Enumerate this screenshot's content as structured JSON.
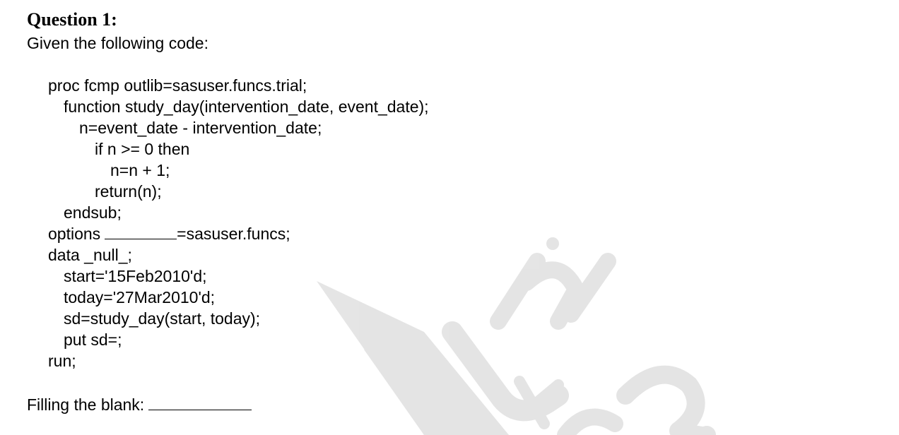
{
  "question": {
    "title": "Question 1:",
    "intro": "Given the following code:"
  },
  "code": {
    "lines": [
      {
        "text": "proc fcmp outlib=sasuser.funcs.trial;"
      },
      {
        "text": "function study_day(intervention_date, event_date);"
      },
      {
        "text": "n=event_date - intervention_date;"
      },
      {
        "text": "if n >= 0 then"
      },
      {
        "text": "n=n + 1;"
      },
      {
        "text": "return(n);"
      },
      {
        "text": "endsub;"
      },
      {
        "text_before_blank": "options",
        "text_after_blank": "=sasuser.funcs;"
      },
      {
        "text": "data _null_;"
      },
      {
        "text": "start='15Feb2010'd;"
      },
      {
        "text": "today='27Mar2010'd;"
      },
      {
        "text": "sd=study_day(start, today);"
      },
      {
        "text": "put sd=;"
      },
      {
        "text": "run;"
      }
    ]
  },
  "answer": {
    "label": "Filling the blank:"
  },
  "colors": {
    "text": "#000000",
    "background": "#ffffff",
    "watermark": "#dcdcdc"
  }
}
